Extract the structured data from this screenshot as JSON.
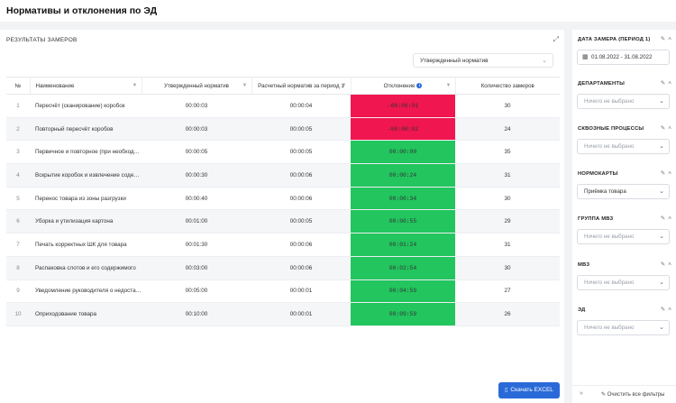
{
  "page": {
    "title": "Нормативы и отклонения по ЭД"
  },
  "results": {
    "header": "РЕЗУЛЬТАТЫ ЗАМЕРОВ",
    "norm_select": {
      "value": "Утвержденный норматив"
    },
    "columns": [
      "№",
      "Наименование",
      "Утвержденный норматив",
      "Расчетный норматив за период 1",
      "Отклонение",
      "Количество замеров"
    ],
    "rows": [
      {
        "num": "1",
        "name": "Пересчёт (сканирование) коробок",
        "approved": "00:00:03",
        "calculated": "00:00:04",
        "deviation": "-00:00:01",
        "status": "negative",
        "count": "30"
      },
      {
        "num": "2",
        "name": "Повторный пересчёт коробов",
        "approved": "00:00:03",
        "calculated": "00:00:05",
        "deviation": "-00:00:02",
        "status": "negative",
        "count": "24"
      },
      {
        "num": "3",
        "name": "Первичное и повторное (при необходимости)",
        "approved": "00:00:05",
        "calculated": "00:00:05",
        "deviation": "00:00:00",
        "status": "positive",
        "count": "35"
      },
      {
        "num": "4",
        "name": "Вскрытие коробок и извлечение содержимого",
        "approved": "00:00:30",
        "calculated": "00:00:06",
        "deviation": "00:00:24",
        "status": "positive",
        "count": "31"
      },
      {
        "num": "5",
        "name": "Перенос товара из зоны разгрузки",
        "approved": "00:00:40",
        "calculated": "00:00:06",
        "deviation": "00:00:34",
        "status": "positive",
        "count": "30"
      },
      {
        "num": "6",
        "name": "Уборка и утилизация картона",
        "approved": "00:01:00",
        "calculated": "00:00:05",
        "deviation": "00:00:55",
        "status": "positive",
        "count": "29"
      },
      {
        "num": "7",
        "name": "Печать корректных ШК для товара",
        "approved": "00:01:30",
        "calculated": "00:00:06",
        "deviation": "00:01:24",
        "status": "positive",
        "count": "31"
      },
      {
        "num": "8",
        "name": "Распаковка слотов и его содержимого",
        "approved": "00:03:00",
        "calculated": "00:00:06",
        "deviation": "00:02:54",
        "status": "positive",
        "count": "30"
      },
      {
        "num": "9",
        "name": "Уведомление руководителя о недостаче",
        "approved": "00:05:00",
        "calculated": "00:00:01",
        "deviation": "00:04:59",
        "status": "positive",
        "count": "27"
      },
      {
        "num": "10",
        "name": "Оприходование товара",
        "approved": "00:10:00",
        "calculated": "00:00:01",
        "deviation": "00:09:59",
        "status": "positive",
        "count": "26"
      }
    ],
    "download_label": "Скачать EXCEL"
  },
  "filters": {
    "date": {
      "label": "ДАТА ЗАМЕРА (ПЕРИОД 1)",
      "value": "01.08.2022 - 31.08.2022"
    },
    "departments": {
      "label": "ДЕПАРТАМЕНТЫ",
      "placeholder": "Ничего не выбрано"
    },
    "processes": {
      "label": "СКВОЗНЫЕ ПРОЦЕССЫ",
      "placeholder": "Ничего не выбрано"
    },
    "normcards": {
      "label": "НОРМОКАРТЫ",
      "value": "Приёмка товара"
    },
    "mvz_group": {
      "label": "ГРУППА МВЗ",
      "placeholder": "Ничего не выбрано"
    },
    "mvz": {
      "label": "МВЗ",
      "placeholder": "Ничего не выбрано"
    },
    "ed": {
      "label": "ЭД",
      "placeholder": "Ничего не выбрано"
    },
    "clear_label": "Очистить все фильтры"
  },
  "colors": {
    "negative": "#f0164f",
    "positive": "#22c55e",
    "accent": "#2a6ad8"
  },
  "icons": [
    "expand-icon",
    "chevron-down-icon",
    "filter-icon",
    "info-icon",
    "download-icon",
    "calendar-icon",
    "pencil-icon",
    "chevron-up-icon",
    "collapse-panel-icon",
    "eraser-icon"
  ]
}
